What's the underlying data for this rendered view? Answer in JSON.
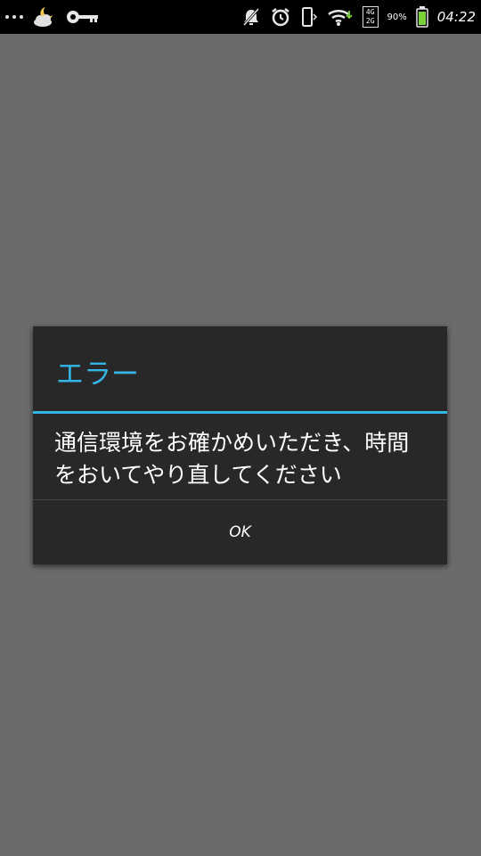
{
  "status_bar": {
    "net_top": "4G",
    "net_bottom": "2G",
    "battery_percent": "90%",
    "time": "04:22",
    "icons": [
      "more-dots-icon",
      "weather-moon-cloud-icon",
      "key-icon",
      "notifications-muted-icon",
      "alarm-clock-icon",
      "phone-vibrate-icon",
      "wifi-icon",
      "battery-icon"
    ]
  },
  "dialog": {
    "title": "エラー",
    "message": "通信環境をお確かめいただき、時間をおいてやり直してください",
    "ok_label": "OK"
  },
  "colors": {
    "accent": "#33b5e5",
    "dialog_bg": "#282828",
    "overlay_bg": "#6b6b6b",
    "battery": "#7cd13b"
  }
}
